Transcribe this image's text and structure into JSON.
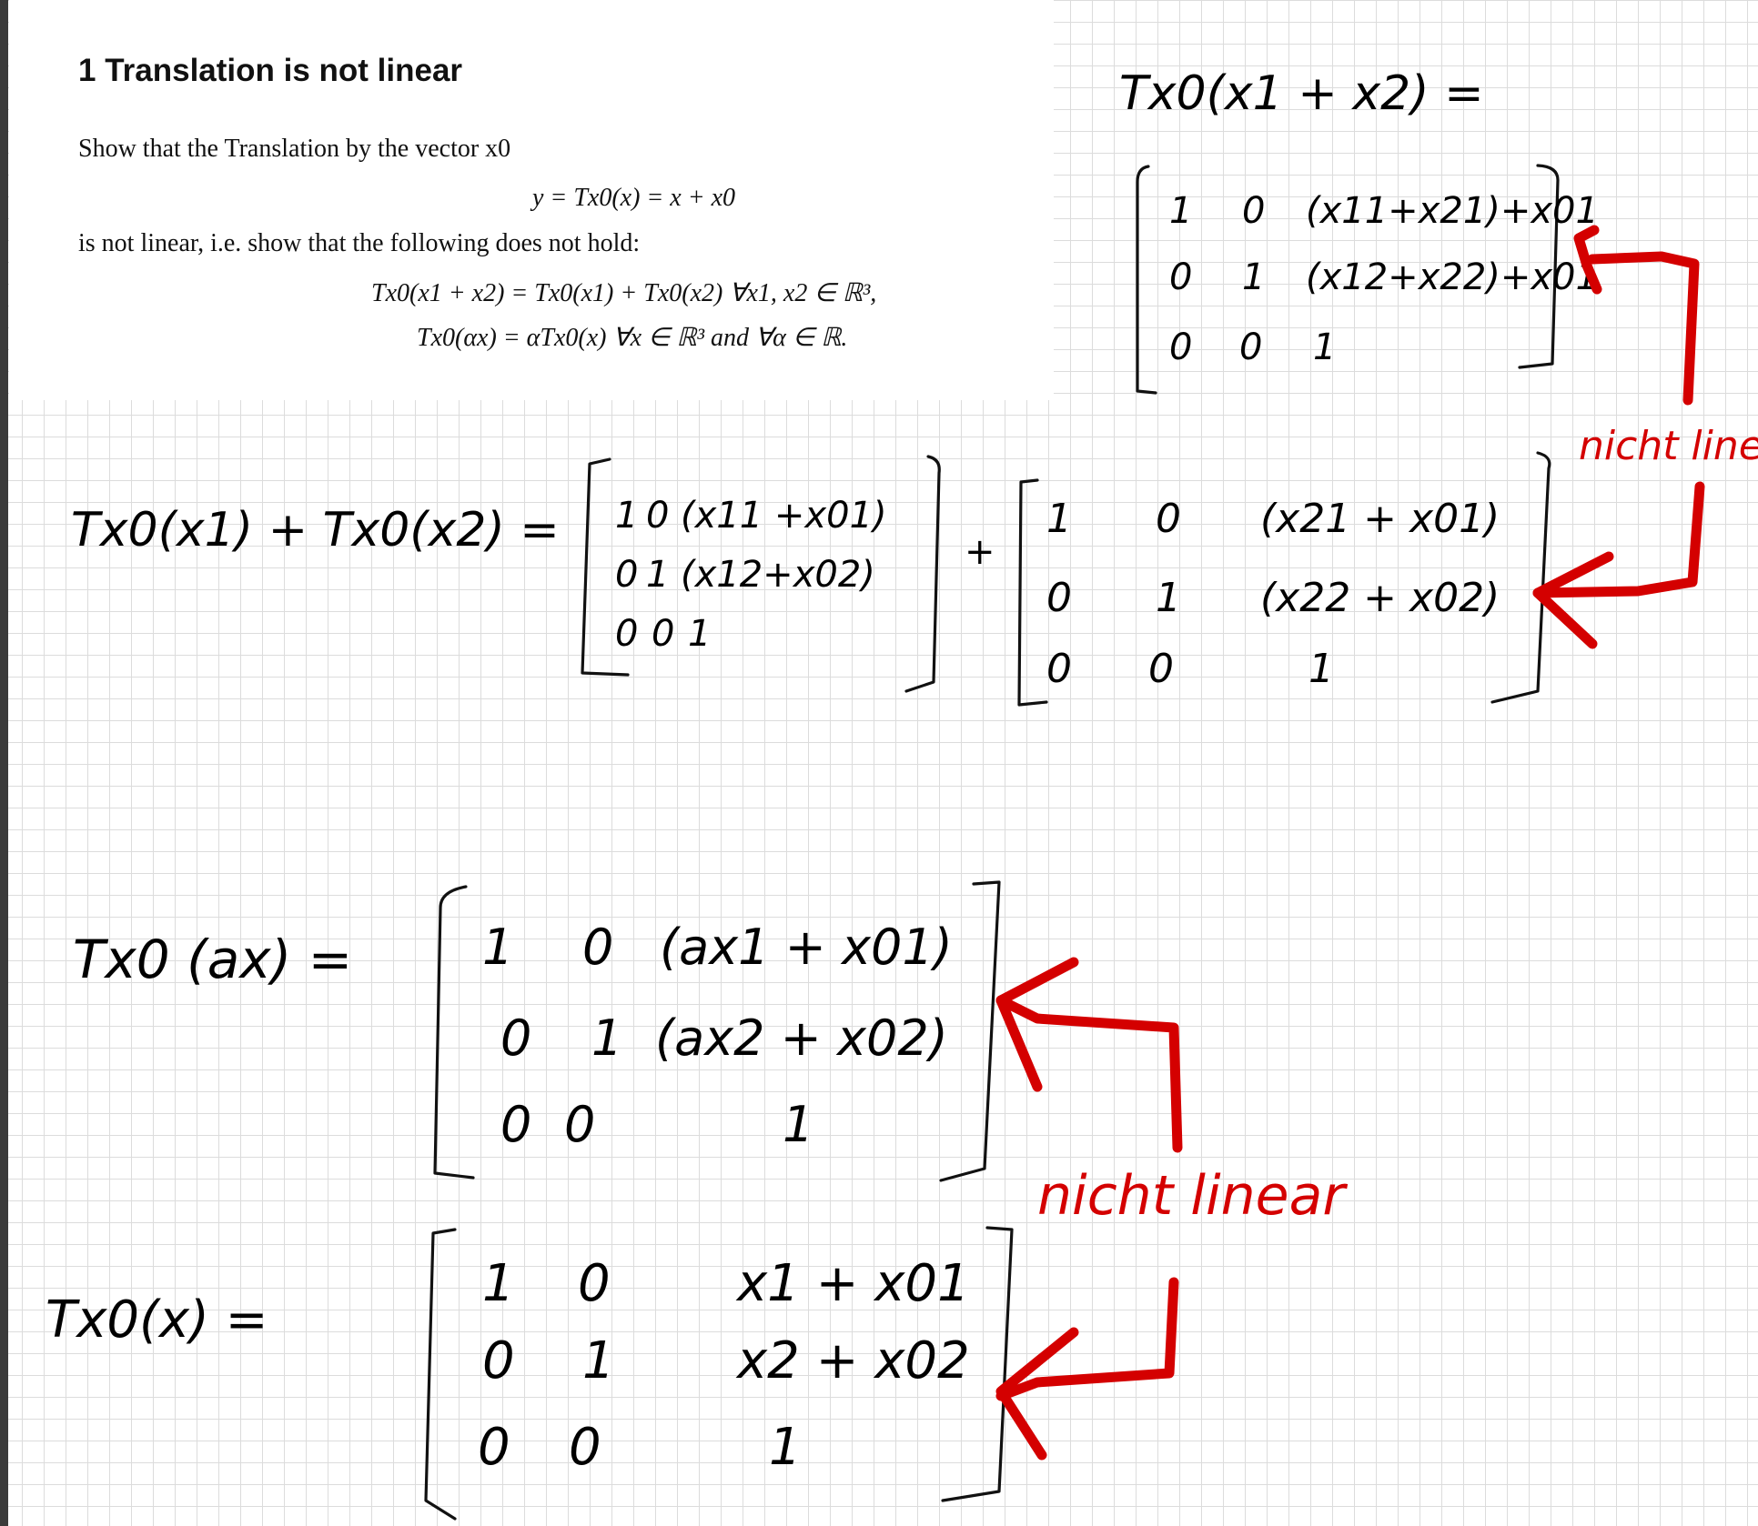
{
  "task": {
    "title": "1  Translation is not linear",
    "intro": "Show that the Translation by the vector x0",
    "definition": "y = Tx0(x)  =  x + x0",
    "not_linear": "is not linear, i.e. show that the following does not hold:",
    "additivity": "Tx0(x1 + x2) = Tx0(x1) + Tx0(x2)    ∀x1, x2 ∈ ℝ³,",
    "homogeneity": "Tx0(αx) = αTx0(x)        ∀x ∈ ℝ³ and ∀α ∈ ℝ."
  },
  "handwriting": {
    "sum_lhs": "Tx0(x1 + x2) =",
    "sum_matrix": [
      [
        "1",
        "0",
        "(x11+x21)+x01"
      ],
      [
        "0",
        "1",
        "(x12+x22)+x01"
      ],
      [
        "0",
        "0",
        "1"
      ]
    ],
    "split_lhs": "Tx0(x1) + Tx0(x2) =",
    "split_matrix_a": [
      [
        "1",
        "0",
        "(x11 +x01)"
      ],
      [
        "0",
        "1",
        "(x12+x02)"
      ],
      [
        "0",
        "0",
        "1"
      ]
    ],
    "split_matrix_b": [
      [
        "1",
        "0",
        "(x21 + x01)"
      ],
      [
        "0",
        "1",
        "(x22 + x02)"
      ],
      [
        "0",
        "0",
        "1"
      ]
    ],
    "plus": "+",
    "scale_lhs": "Tx0 (ax) =",
    "scale_matrix": [
      [
        "1",
        "0",
        "(ax1 + x01)"
      ],
      [
        "0",
        "1",
        "(ax2 + x02)"
      ],
      [
        "0",
        "0",
        "1"
      ]
    ],
    "unit_lhs": "Tx0(x) =",
    "unit_matrix": [
      [
        "1",
        "0",
        "x1 + x01"
      ],
      [
        "0",
        "1",
        "x2 + x02"
      ],
      [
        "0",
        "0",
        "1"
      ]
    ],
    "note_top": "nicht linear",
    "note_bottom": "nicht linear"
  },
  "colors": {
    "ink": "#111111",
    "annotation": "#d40000",
    "grid": "#dcdcdc"
  }
}
